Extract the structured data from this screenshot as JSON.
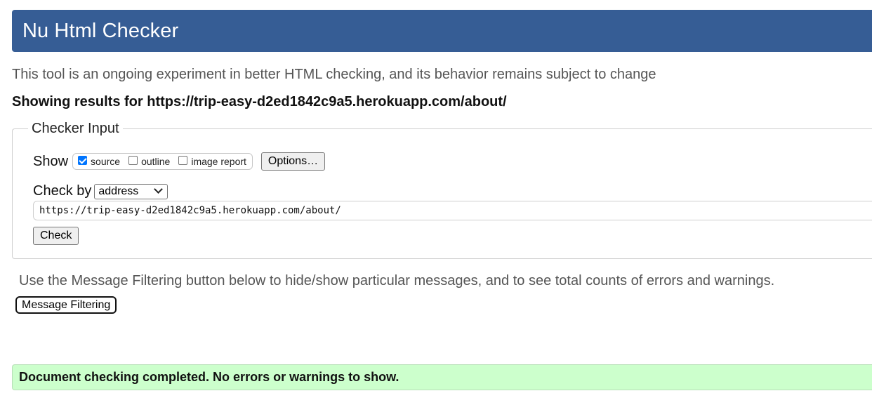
{
  "header": {
    "title": "Nu Html Checker"
  },
  "intro_text": "This tool is an ongoing experiment in better HTML checking, and its behavior remains subject to change",
  "results_heading": "Showing results for https://trip-easy-d2ed1842c9a5.herokuapp.com/about/",
  "checker_input": {
    "legend": "Checker Input",
    "show_label": "Show",
    "show_options": [
      {
        "label": "source",
        "checked": true
      },
      {
        "label": "outline",
        "checked": false
      },
      {
        "label": "image report",
        "checked": false
      }
    ],
    "options_button": "Options…",
    "check_by_label": "Check by",
    "check_by_selected": "address",
    "url_value": "https://trip-easy-d2ed1842c9a5.herokuapp.com/about/",
    "check_button": "Check"
  },
  "filtering": {
    "note": "Use the Message Filtering button below to hide/show particular messages, and to see total counts of errors and warnings.",
    "button": "Message Filtering"
  },
  "status": {
    "message": "Document checking completed. No errors or warnings to show.",
    "color": "#ccffcc"
  },
  "colors": {
    "header_bg": "#365d95",
    "checkbox_accent": "#0075ff"
  }
}
